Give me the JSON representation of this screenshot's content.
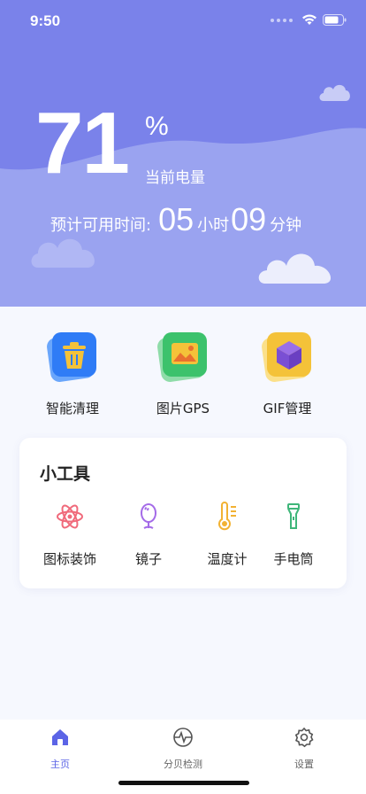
{
  "status_bar": {
    "time": "9:50"
  },
  "battery": {
    "percent": "71",
    "percent_sign": "%",
    "caption": "当前电量",
    "remaining_label": "预计可用时间:",
    "hours": "05",
    "hours_unit": "小时",
    "minutes": "09",
    "minutes_unit": "分钟"
  },
  "features": [
    {
      "label": "智能清理",
      "icon": "trash-icon"
    },
    {
      "label": "图片GPS",
      "icon": "picture-icon"
    },
    {
      "label": "GIF管理",
      "icon": "cube-icon"
    }
  ],
  "tools": {
    "title": "小工具",
    "items": [
      {
        "label": "图标装饰",
        "icon": "atom-icon"
      },
      {
        "label": "镜子",
        "icon": "mirror-icon"
      },
      {
        "label": "温度计",
        "icon": "thermometer-icon"
      },
      {
        "label": "手电筒",
        "icon": "flashlight-icon"
      }
    ]
  },
  "tabbar": {
    "items": [
      {
        "label": "主页",
        "icon": "home-icon",
        "active": true
      },
      {
        "label": "分贝检测",
        "icon": "decibel-icon",
        "active": false
      },
      {
        "label": "设置",
        "icon": "gear-icon",
        "active": false
      }
    ]
  },
  "colors": {
    "hero": "#7a82ea",
    "accent": "#5b64e6",
    "trash": "#2f7cf6",
    "picture": "#3cc26c",
    "gif": "#f4c239",
    "atom": "#f06a7b",
    "mirror": "#a46be8",
    "thermometer": "#f2b233",
    "flashlight": "#3fb67a"
  }
}
